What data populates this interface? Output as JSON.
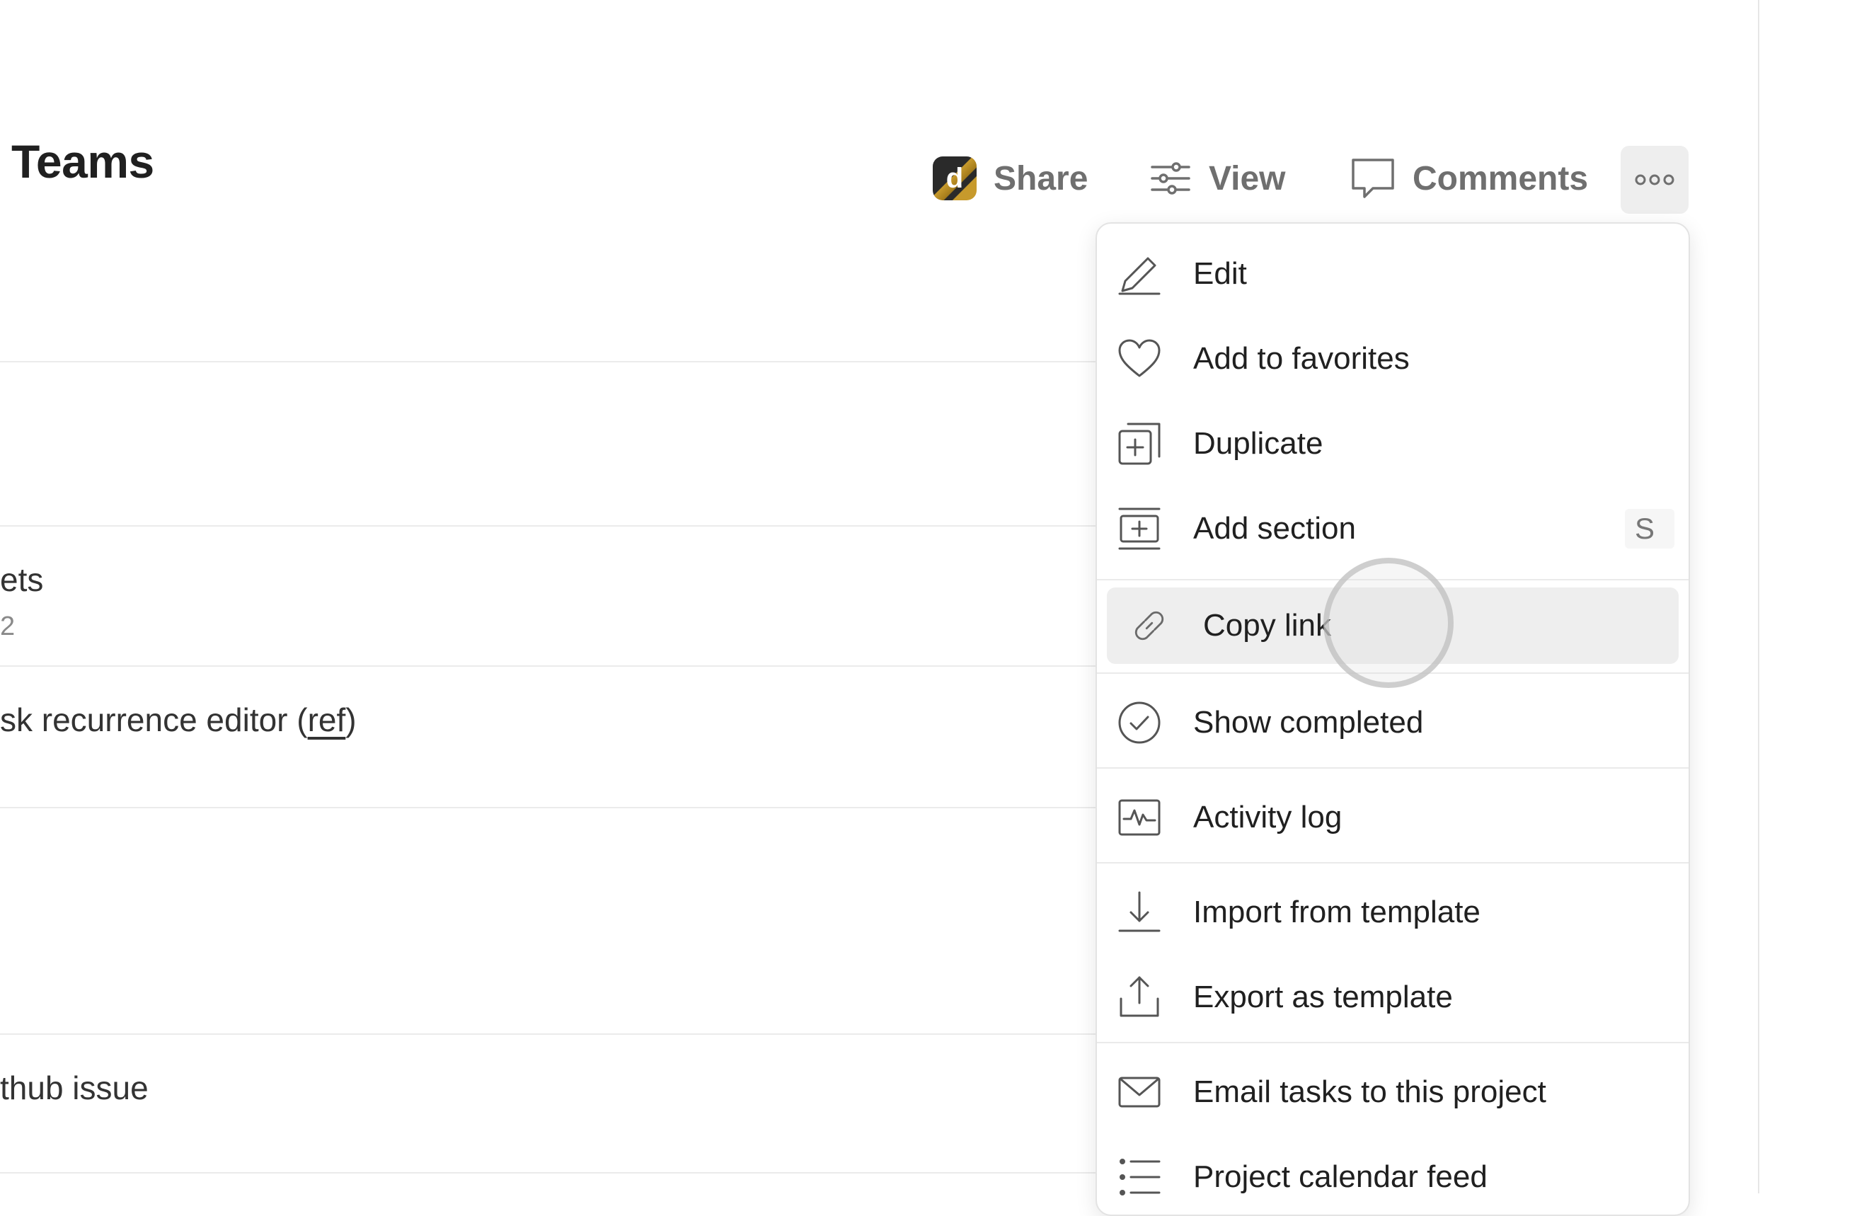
{
  "header": {
    "title": "Teams",
    "share_label": "Share",
    "avatar_letter": "d",
    "view_label": "View",
    "comments_label": "Comments"
  },
  "rows": {
    "r1_text": "ets",
    "r1_sub": "2",
    "r2_text_prefix": "sk recurrence editor (",
    "r2_link": "ref",
    "r2_text_suffix": ")",
    "r3_text": "thub issue"
  },
  "menu": {
    "items": [
      {
        "label": "Edit",
        "icon": "pencil-icon"
      },
      {
        "label": "Add to favorites",
        "icon": "heart-icon"
      },
      {
        "label": "Duplicate",
        "icon": "duplicate-icon"
      },
      {
        "label": "Add section",
        "icon": "add-section-icon",
        "shortcut": "S"
      },
      {
        "label": "Copy link",
        "icon": "link-icon"
      },
      {
        "label": "Show completed",
        "icon": "check-circle-icon"
      },
      {
        "label": "Activity log",
        "icon": "activity-icon"
      },
      {
        "label": "Import from template",
        "icon": "import-icon"
      },
      {
        "label": "Export as template",
        "icon": "export-icon"
      },
      {
        "label": "Email tasks to this project",
        "icon": "mail-icon"
      },
      {
        "label": "Project calendar feed",
        "icon": "list-icon"
      }
    ]
  }
}
